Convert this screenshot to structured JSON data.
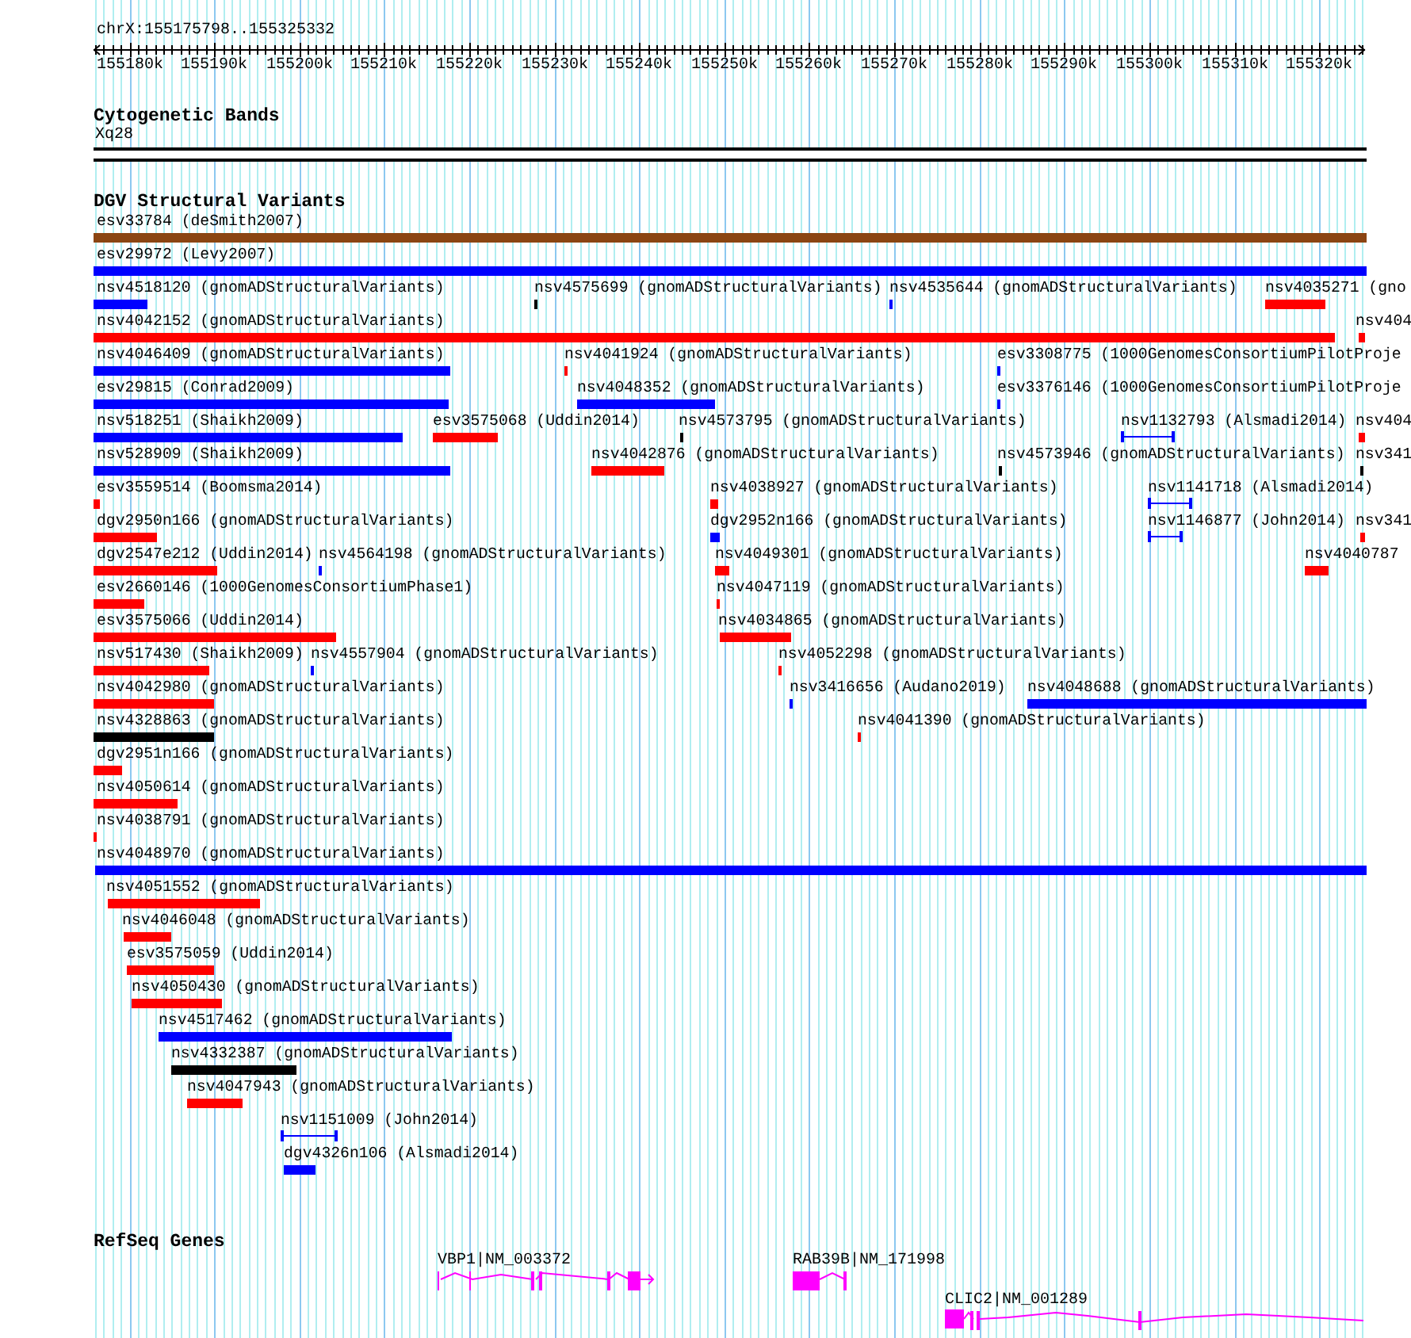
{
  "locus": "chrX:155175798..155325332",
  "ruler": {
    "ticks": [
      "155180k",
      "155190k",
      "155200k",
      "155210k",
      "155220k",
      "155230k",
      "155240k",
      "155250k",
      "155260k",
      "155270k",
      "155280k",
      "155290k",
      "155300k",
      "155310k",
      "155320k"
    ]
  },
  "cytogenetic_bands": {
    "title": "Cytogenetic Bands",
    "bands": [
      {
        "label": "Xq28"
      }
    ]
  },
  "dgv_track": {
    "title": "DGV Structural Variants",
    "lanes": [
      [
        {
          "label": "esv33784 (deSmith2007)",
          "color": "#8b4513",
          "kind": "bar"
        }
      ],
      [
        {
          "label": "esv29972 (Levy2007)",
          "color": "#0000ff",
          "kind": "bar"
        }
      ],
      [
        {
          "label": "nsv4518120 (gnomADStructuralVariants)",
          "color": "#0000ff",
          "kind": "bar"
        },
        {
          "label": "nsv4575699 (gnomADStructuralVariants)",
          "color": "#000000",
          "kind": "bar"
        },
        {
          "label": "nsv4535644 (gnomADStructuralVariants)",
          "color": "#0000ff",
          "kind": "bar"
        },
        {
          "label": "nsv4035271 (gno",
          "color": "#ff0000",
          "kind": "bar"
        }
      ],
      [
        {
          "label": "nsv4042152 (gnomADStructuralVariants)",
          "color": "#ff0000",
          "kind": "bar"
        },
        {
          "label": "nsv404",
          "color": "#ff0000",
          "kind": "bar"
        }
      ],
      [
        {
          "label": "nsv4046409 (gnomADStructuralVariants)",
          "color": "#0000ff",
          "kind": "bar"
        },
        {
          "label": "nsv4041924 (gnomADStructuralVariants)",
          "color": "#ff0000",
          "kind": "bar"
        },
        {
          "label": "esv3308775 (1000GenomesConsortiumPilotProje",
          "color": "#0000ff",
          "kind": "bar"
        }
      ],
      [
        {
          "label": "esv29815 (Conrad2009)",
          "color": "#0000ff",
          "kind": "bar"
        },
        {
          "label": "nsv4048352 (gnomADStructuralVariants)",
          "color": "#0000ff",
          "kind": "bar"
        },
        {
          "label": "esv3376146 (1000GenomesConsortiumPilotProje",
          "color": "#0000ff",
          "kind": "bar"
        }
      ],
      [
        {
          "label": "nsv518251 (Shaikh2009)",
          "color": "#0000ff",
          "kind": "bar"
        },
        {
          "label": "esv3575068 (Uddin2014)",
          "color": "#ff0000",
          "kind": "bar"
        },
        {
          "label": "nsv4573795 (gnomADStructuralVariants)",
          "color": "#000000",
          "kind": "bar"
        },
        {
          "label": "nsv1132793 (Alsmadi2014)",
          "color": "#0000ff",
          "kind": "interval"
        },
        {
          "label": "nsv404",
          "color": "#ff0000",
          "kind": "bar"
        }
      ],
      [
        {
          "label": "nsv528909 (Shaikh2009)",
          "color": "#0000ff",
          "kind": "bar"
        },
        {
          "label": "nsv4042876 (gnomADStructuralVariants)",
          "color": "#ff0000",
          "kind": "bar"
        },
        {
          "label": "nsv4573946 (gnomADStructuralVariants)",
          "color": "#000000",
          "kind": "bar"
        },
        {
          "label": "nsv341",
          "color": "#000000",
          "kind": "bar"
        }
      ],
      [
        {
          "label": "esv3559514 (Boomsma2014)",
          "color": "#ff0000",
          "kind": "bar"
        },
        {
          "label": "nsv4038927 (gnomADStructuralVariants)",
          "color": "#ff0000",
          "kind": "bar"
        },
        {
          "label": "nsv1141718 (Alsmadi2014)",
          "color": "#0000ff",
          "kind": "interval"
        }
      ],
      [
        {
          "label": "dgv2950n166 (gnomADStructuralVariants)",
          "color": "#ff0000",
          "kind": "bar"
        },
        {
          "label": "dgv2952n166 (gnomADStructuralVariants)",
          "color": "#0000ff",
          "kind": "bar"
        },
        {
          "label": "nsv1146877 (John2014)",
          "color": "#0000ff",
          "kind": "interval"
        },
        {
          "label": "nsv341",
          "color": "#ff0000",
          "kind": "bar"
        }
      ],
      [
        {
          "label": "dgv2547e212 (Uddin2014)",
          "color": "#ff0000",
          "kind": "bar"
        },
        {
          "label": "nsv4564198 (gnomADStructuralVariants)",
          "color": "#0000ff",
          "kind": "bar"
        },
        {
          "label": "nsv4049301 (gnomADStructuralVariants)",
          "color": "#ff0000",
          "kind": "bar"
        },
        {
          "label": "nsv4040787",
          "color": "#ff0000",
          "kind": "bar"
        }
      ],
      [
        {
          "label": "esv2660146 (1000GenomesConsortiumPhase1)",
          "color": "#ff0000",
          "kind": "bar"
        },
        {
          "label": "nsv4047119 (gnomADStructuralVariants)",
          "color": "#ff0000",
          "kind": "bar"
        }
      ],
      [
        {
          "label": "esv3575066 (Uddin2014)",
          "color": "#ff0000",
          "kind": "bar"
        },
        {
          "label": "nsv4034865 (gnomADStructuralVariants)",
          "color": "#ff0000",
          "kind": "bar"
        }
      ],
      [
        {
          "label": "nsv517430 (Shaikh2009)",
          "color": "#ff0000",
          "kind": "bar"
        },
        {
          "label": "nsv4557904 (gnomADStructuralVariants)",
          "color": "#0000ff",
          "kind": "bar"
        },
        {
          "label": "nsv4052298 (gnomADStructuralVariants)",
          "color": "#ff0000",
          "kind": "bar"
        }
      ],
      [
        {
          "label": "nsv4042980 (gnomADStructuralVariants)",
          "color": "#ff0000",
          "kind": "bar"
        },
        {
          "label": "nsv3416656 (Audano2019)",
          "color": "#0000ff",
          "kind": "bar"
        },
        {
          "label": "nsv4048688 (gnomADStructuralVariants)",
          "color": "#0000ff",
          "kind": "bar"
        }
      ],
      [
        {
          "label": "nsv4328863 (gnomADStructuralVariants)",
          "color": "#000000",
          "kind": "bar"
        },
        {
          "label": "nsv4041390 (gnomADStructuralVariants)",
          "color": "#ff0000",
          "kind": "bar"
        }
      ],
      [
        {
          "label": "dgv2951n166 (gnomADStructuralVariants)",
          "color": "#ff0000",
          "kind": "bar"
        }
      ],
      [
        {
          "label": "nsv4050614 (gnomADStructuralVariants)",
          "color": "#ff0000",
          "kind": "bar"
        }
      ],
      [
        {
          "label": "nsv4038791 (gnomADStructuralVariants)",
          "color": "#ff0000",
          "kind": "bar"
        }
      ],
      [
        {
          "label": "nsv4048970 (gnomADStructuralVariants)",
          "color": "#0000ff",
          "kind": "bar"
        }
      ],
      [
        {
          "label": "nsv4051552 (gnomADStructuralVariants)",
          "color": "#ff0000",
          "kind": "bar"
        }
      ],
      [
        {
          "label": "nsv4046048 (gnomADStructuralVariants)",
          "color": "#ff0000",
          "kind": "bar"
        }
      ],
      [
        {
          "label": "esv3575059 (Uddin2014)",
          "color": "#ff0000",
          "kind": "bar"
        }
      ],
      [
        {
          "label": "nsv4050430 (gnomADStructuralVariants)",
          "color": "#ff0000",
          "kind": "bar"
        }
      ],
      [
        {
          "label": "nsv4517462 (gnomADStructuralVariants)",
          "color": "#0000ff",
          "kind": "bar"
        }
      ],
      [
        {
          "label": "nsv4332387 (gnomADStructuralVariants)",
          "color": "#000000",
          "kind": "bar"
        }
      ],
      [
        {
          "label": "nsv4047943 (gnomADStructuralVariants)",
          "color": "#ff0000",
          "kind": "bar"
        }
      ],
      [
        {
          "label": "nsv1151009 (John2014)",
          "color": "#0000ff",
          "kind": "interval"
        }
      ],
      [
        {
          "label": "dgv4326n106 (Alsmadi2014)",
          "color": "#0000ff",
          "kind": "bar"
        }
      ]
    ]
  },
  "refseq_genes": {
    "title": "RefSeq Genes",
    "genes": [
      {
        "label": "VBP1|NM_003372"
      },
      {
        "label": "RAB39B|NM_171998"
      },
      {
        "label": "CLIC2|NM_001289"
      }
    ]
  }
}
